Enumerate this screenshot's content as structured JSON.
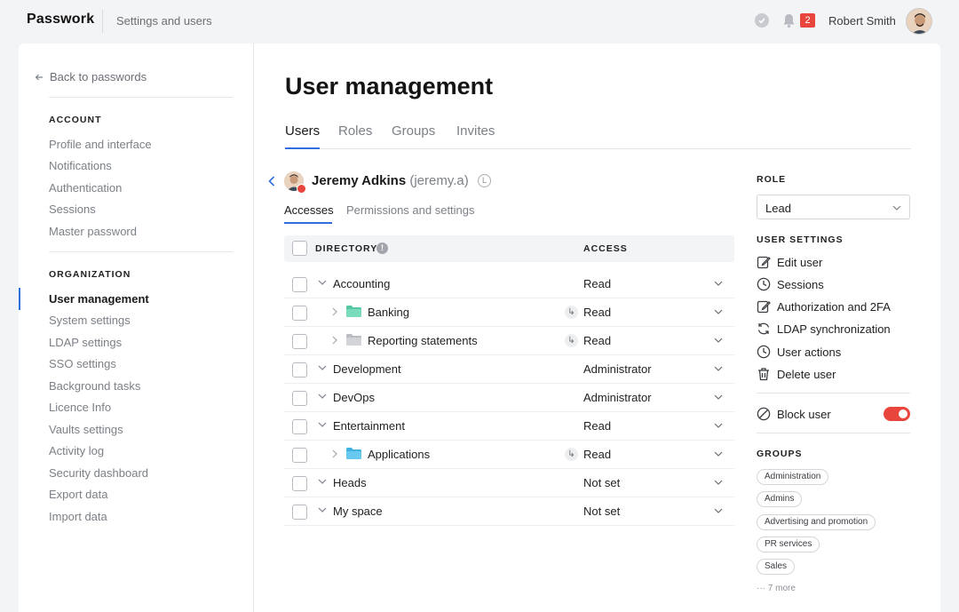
{
  "app": {
    "brand": "Passwork",
    "section": "Settings and users",
    "notifications_count": "2",
    "user_name": "Robert Smith",
    "accent": "#2f6fe0",
    "danger": "#e8453c"
  },
  "sidebar": {
    "back_label": "Back to passwords",
    "account_heading": "ACCOUNT",
    "account_items": [
      "Profile and interface",
      "Notifications",
      "Authentication",
      "Sessions",
      "Master password"
    ],
    "organization_heading": "ORGANIZATION",
    "organization_items": [
      "User management",
      "System settings",
      "LDAP settings",
      "SSO settings",
      "Background tasks",
      "Licence Info",
      "Vaults settings",
      "Activity log",
      "Security dashboard",
      "Export data",
      "Import data"
    ],
    "active_item": "User management"
  },
  "main": {
    "title": "User management",
    "tabs": [
      "Users",
      "Roles",
      "Groups",
      "Invites"
    ],
    "active_tab": "Users",
    "user": {
      "name": "Jeremy Adkins",
      "login": "(jeremy.a)",
      "badge": "L"
    },
    "subtabs": [
      "Accesses",
      "Permissions and settings"
    ],
    "active_subtab": "Accesses",
    "table": {
      "col_directory": "DIRECTORY",
      "col_access": "ACCESS",
      "rows": [
        {
          "name": "Accounting",
          "access": "Read",
          "level": 0,
          "folder": "",
          "inherited": false
        },
        {
          "name": "Banking",
          "access": "Read",
          "level": 1,
          "folder": "green",
          "inherited": true
        },
        {
          "name": "Reporting statements",
          "access": "Read",
          "level": 1,
          "folder": "grey",
          "inherited": true
        },
        {
          "name": "Development",
          "access": "Administrator",
          "level": 0,
          "folder": "",
          "inherited": false
        },
        {
          "name": "DevOps",
          "access": "Administrator",
          "level": 0,
          "folder": "",
          "inherited": false
        },
        {
          "name": "Entertainment",
          "access": "Read",
          "level": 0,
          "folder": "",
          "inherited": false
        },
        {
          "name": "Applications",
          "access": "Read",
          "level": 1,
          "folder": "blue",
          "inherited": true
        },
        {
          "name": "Heads",
          "access": "Not set",
          "level": 0,
          "folder": "",
          "inherited": false
        },
        {
          "name": "My space",
          "access": "Not set",
          "level": 0,
          "folder": "",
          "inherited": false
        }
      ]
    }
  },
  "panel": {
    "role_heading": "ROLE",
    "role_value": "Lead",
    "settings_heading": "USER SETTINGS",
    "settings_items": [
      {
        "label": "Edit user",
        "icon": "edit-icon"
      },
      {
        "label": "Sessions",
        "icon": "clock-icon"
      },
      {
        "label": "Authorization and 2FA",
        "icon": "edit-auth-icon"
      },
      {
        "label": "LDAP synchronization",
        "icon": "sync-icon"
      },
      {
        "label": "User actions",
        "icon": "clock-icon"
      },
      {
        "label": "Delete user",
        "icon": "trash-icon"
      }
    ],
    "block_label": "Block user",
    "block_enabled": true,
    "groups_heading": "GROUPS",
    "groups": [
      "Administration",
      "Admins",
      "Advertising and promotion",
      "PR services",
      "Sales"
    ],
    "more_label": "7 more"
  }
}
